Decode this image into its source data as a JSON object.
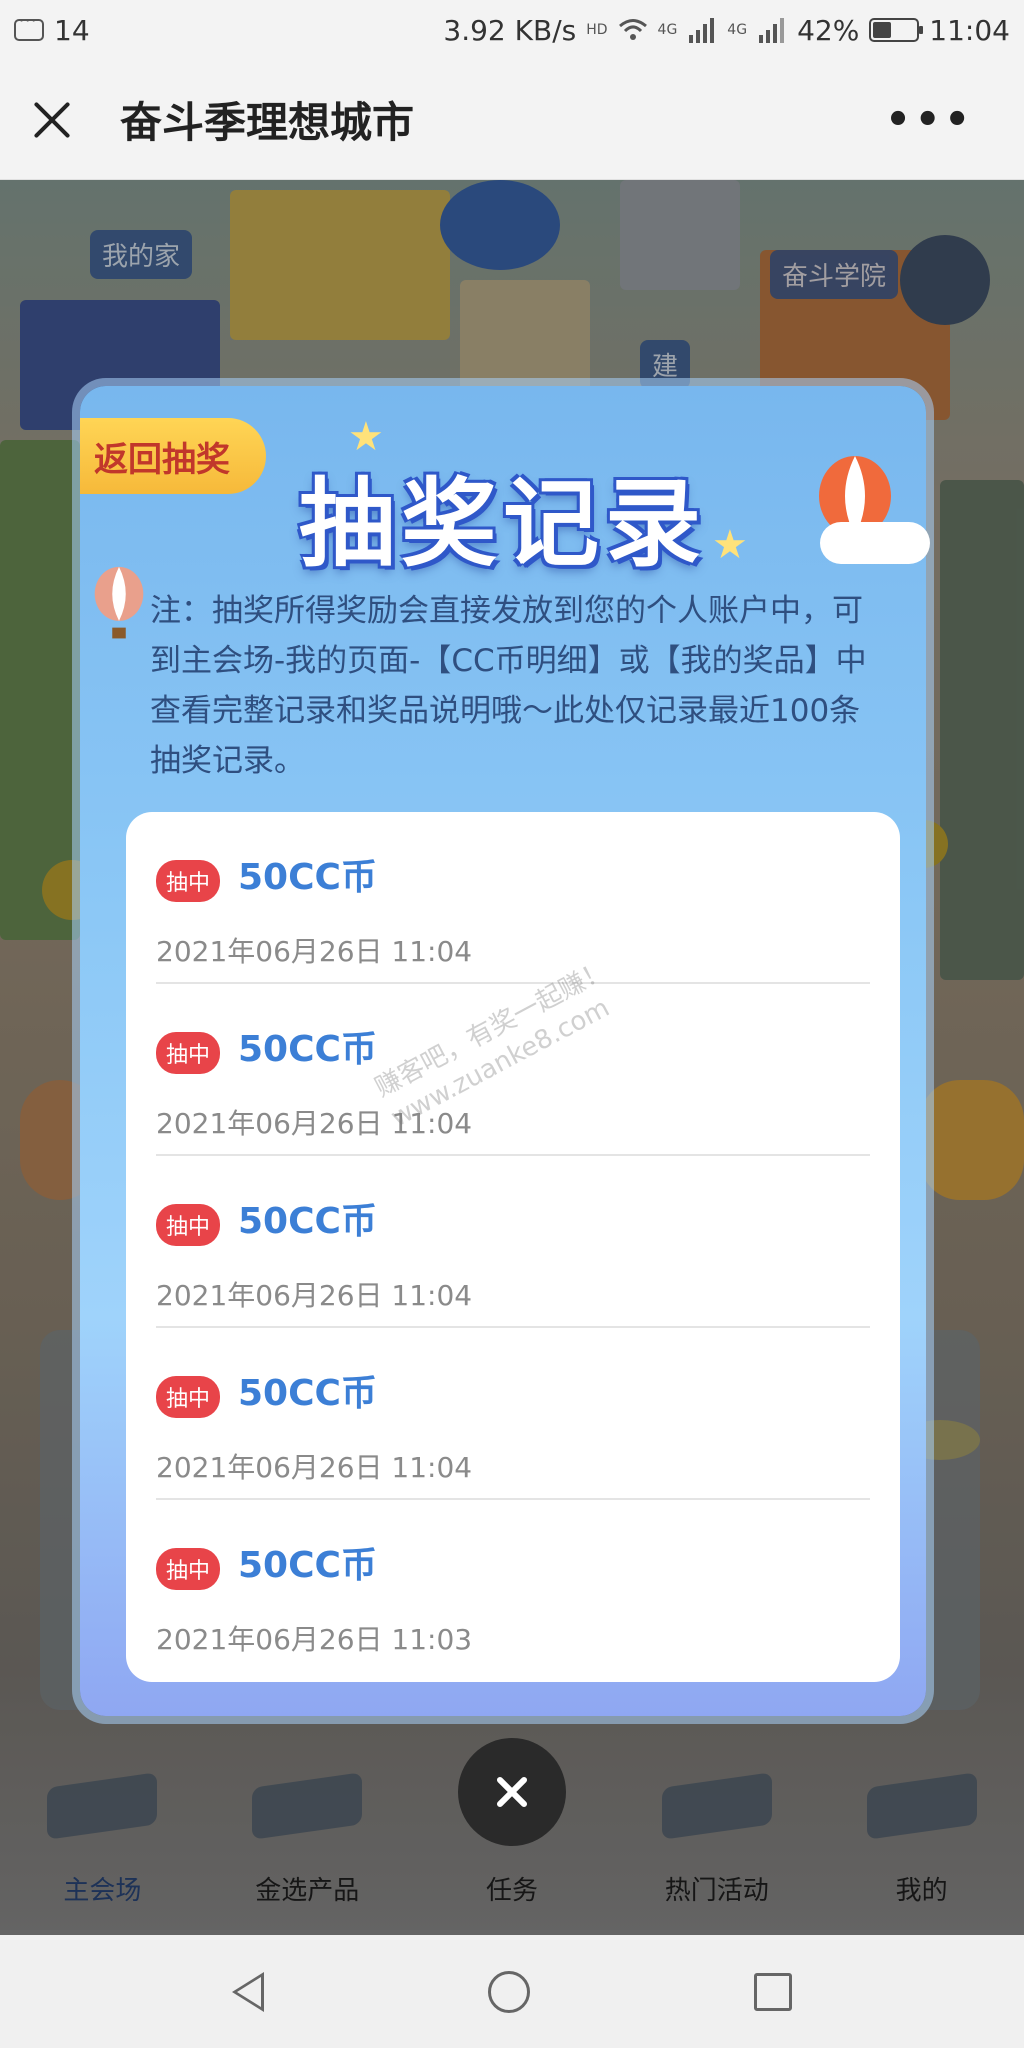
{
  "status_bar": {
    "notification_count": "14",
    "net_speed": "3.92 KB/s",
    "hd_label": "HD",
    "net_type_1": "4G",
    "net_type_2": "4G",
    "battery": "42%",
    "battery_level": 0.42,
    "time": "11:04"
  },
  "app_bar": {
    "title": "奋斗季理想城市",
    "more_label": "•••"
  },
  "background_signs": {
    "home": "我的家",
    "academy": "奋斗学院",
    "build": "建"
  },
  "modal": {
    "back_label": "返回抽奖",
    "title": "抽奖记录",
    "note": "注：抽奖所得奖励会直接发放到您的个人账户中，可到主会场-我的页面-【CC币明细】或【我的奖品】中查看完整记录和奖品说明哦～此处仅记录最近100条抽奖记录。",
    "records": [
      {
        "badge": "抽中",
        "prize": "50CC币",
        "time": "2021年06月26日 11:04"
      },
      {
        "badge": "抽中",
        "prize": "50CC币",
        "time": "2021年06月26日 11:04"
      },
      {
        "badge": "抽中",
        "prize": "50CC币",
        "time": "2021年06月26日 11:04"
      },
      {
        "badge": "抽中",
        "prize": "50CC币",
        "time": "2021年06月26日 11:04"
      },
      {
        "badge": "抽中",
        "prize": "50CC币",
        "time": "2021年06月26日 11:03"
      }
    ]
  },
  "watermark": {
    "line1": "赚客吧，有奖一起赚！",
    "line2": "www.zuanke8.com"
  },
  "bottom_nav": [
    {
      "label": "主会场"
    },
    {
      "label": "金选产品"
    },
    {
      "label": "任务"
    },
    {
      "label": "热门活动"
    },
    {
      "label": "我的"
    }
  ],
  "colors": {
    "badge_red": "#e84449",
    "prize_blue": "#3c7fd6",
    "modal_blue": "#8cc8f6",
    "back_button_yellow": "#f6b93a"
  }
}
